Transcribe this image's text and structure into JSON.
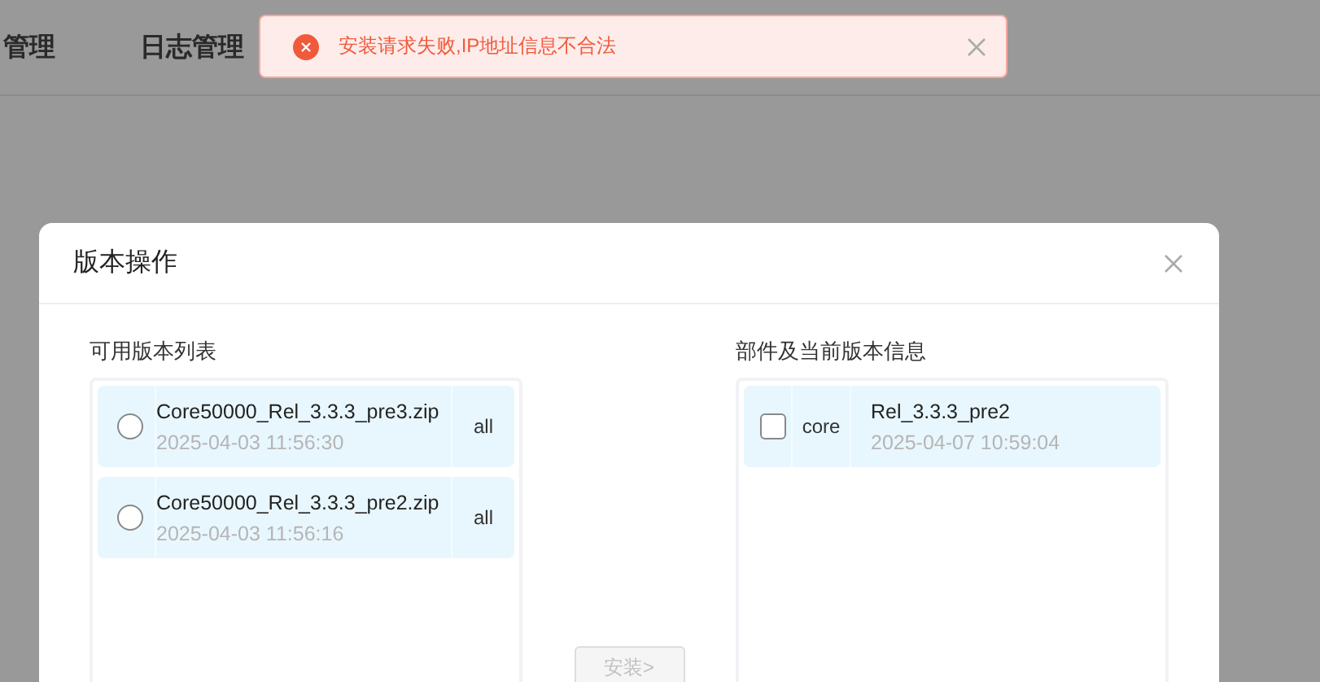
{
  "nav": [
    {
      "label": "管理"
    },
    {
      "label": "日志管理"
    }
  ],
  "toast": {
    "kind": "error",
    "message": "安装请求失败,IP地址信息不合法"
  },
  "dialog": {
    "title": "版本操作",
    "available": {
      "label": "可用版本列表",
      "items": [
        {
          "name": "Core50000_Rel_3.3.3_pre3.zip",
          "time": "2025-04-03 11:56:30",
          "scope": "all",
          "selected": false
        },
        {
          "name": "Core50000_Rel_3.3.3_pre2.zip",
          "time": "2025-04-03 11:56:16",
          "scope": "all",
          "selected": false
        }
      ]
    },
    "install_button": {
      "label": "安装>",
      "disabled": true
    },
    "components": {
      "label": "部件及当前版本信息",
      "items": [
        {
          "component": "core",
          "version": "Rel_3.3.3_pre2",
          "time": "2025-04-07 10:59:04",
          "checked": false
        }
      ]
    }
  }
}
